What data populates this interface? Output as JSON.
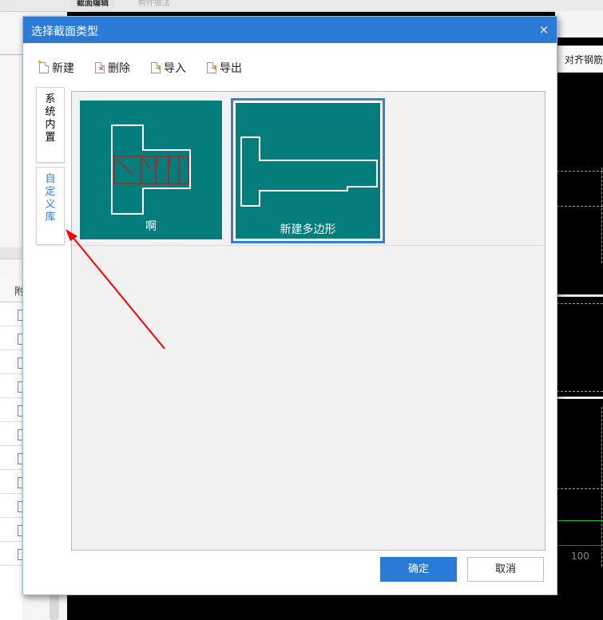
{
  "background": {
    "tabs": [
      "截面编辑",
      "构件做法"
    ],
    "align_label": "对齐钢筋",
    "table_header": "附",
    "ruler_value": "100"
  },
  "dialog": {
    "title": "选择截面类型",
    "close_glyph": "×",
    "toolbar": {
      "new_label": "新建",
      "delete_label": "删除",
      "import_label": "导入",
      "export_label": "导出"
    },
    "side_tabs": {
      "builtin": [
        "系",
        "统",
        "内",
        "置"
      ],
      "custom": [
        "自",
        "定",
        "义",
        "库"
      ]
    },
    "cards": [
      {
        "label": "啊",
        "selected": false
      },
      {
        "label": "新建多边形",
        "selected": true
      }
    ],
    "buttons": {
      "ok": "确定",
      "cancel": "取消"
    }
  },
  "colors": {
    "title_bar": "#2b7bd6",
    "card_fill": "#047d7c",
    "selection_border": "#3480d7",
    "annotation_arrow": "#ff0000",
    "shape_outline": "#ffffff",
    "rebar_outline": "#b22222"
  },
  "annotation": {
    "type": "red-arrow",
    "points_to": "custom library tab"
  }
}
